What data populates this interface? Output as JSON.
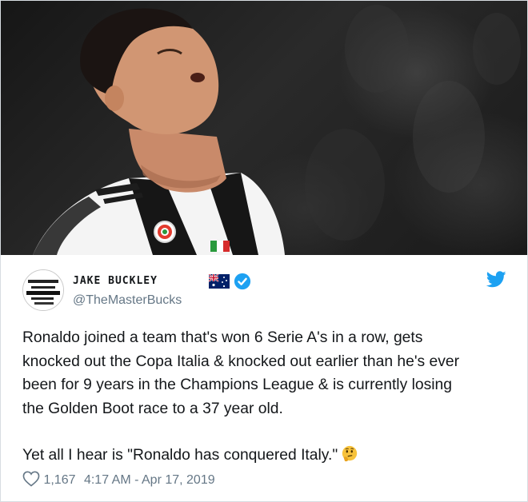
{
  "tweet": {
    "display_name": "JAKE BUCKLEY",
    "flag_icon": "australia-flag-icon",
    "verified_icon": "verified-badge-icon",
    "handle": "@TheMasterBucks",
    "brand_icon": "twitter-bird-icon",
    "brand_color": "#1da1f2",
    "text_lines": [
      "Ronaldo joined a team that's won 6 Serie A's in a row, gets",
      "knocked out the Copa Italia & knocked out earlier than he's ever",
      "been for 9 years in the Champions League & is currently losing",
      "the Golden Boot race to a 37 year old."
    ],
    "text_last_line": "Yet all I hear is \"Ronaldo has conquered Italy.\"",
    "emoji_icon": "thinking-face-emoji-icon",
    "like_count": "1,167",
    "timestamp": "4:17 AM - Apr 17, 2019"
  },
  "colors": {
    "text": "#14171a",
    "secondary": "#657786",
    "border": "#d8dde2"
  }
}
